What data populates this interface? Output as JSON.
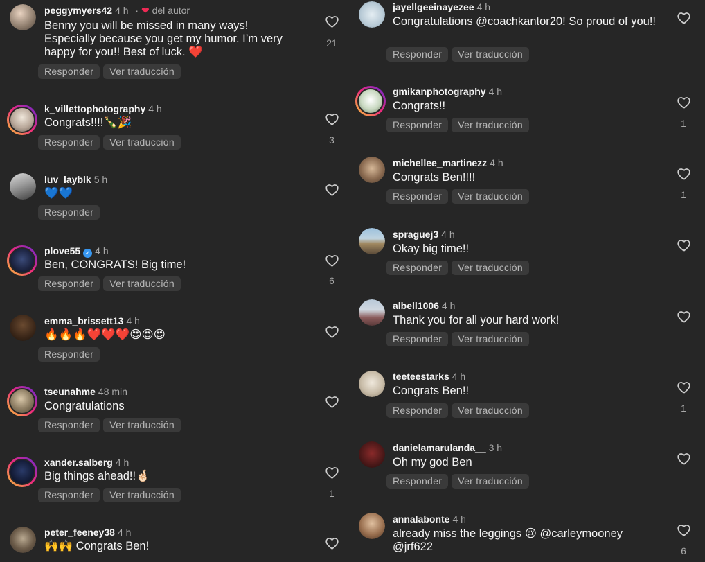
{
  "labels": {
    "reply": "Responder",
    "translate": "Ver traducción"
  },
  "left_comments": [
    {
      "user": "peggymyers42",
      "time": "4 h",
      "by_author": "del autor",
      "text": "Benny you will be missed in many ways! Especially because you get my humor. I’m very happy for you!! Best of luck. ❤️",
      "likes": "21"
    },
    {
      "user": "k_villettophotography",
      "time": "4 h",
      "text": "Congrats!!!!🍾🎉",
      "likes": "3"
    },
    {
      "user": "luv_layblk",
      "time": "5 h",
      "text": "💙💙",
      "likes": ""
    },
    {
      "user": "plove55",
      "time": "4 h",
      "text": "Ben, CONGRATS! Big time!",
      "likes": "6"
    },
    {
      "user": "emma_brissett13",
      "time": "4 h",
      "text": "🔥🔥🔥❤️❤️❤️😍😍😍",
      "likes": ""
    },
    {
      "user": "tseunahme",
      "time": "48 min",
      "text": "Congratulations",
      "likes": ""
    },
    {
      "user": "xander.salberg",
      "time": "4 h",
      "text": "Big things ahead!!🤞🏻",
      "likes": "1"
    },
    {
      "user": "peter_feeney38",
      "time": "4 h",
      "text": "🙌🙌 Congrats Ben!",
      "likes": ""
    }
  ],
  "right_comments": [
    {
      "user": "jayellgeeinayezee",
      "time": "4 h",
      "text": "Congratulations @coachkantor20! So proud of you!!",
      "likes": ""
    },
    {
      "user": "gmikanphotography",
      "time": "4 h",
      "text": "Congrats!!",
      "likes": "1"
    },
    {
      "user": "michellee_martinezz",
      "time": "4 h",
      "text": "Congrats Ben!!!!",
      "likes": "1"
    },
    {
      "user": "spraguej3",
      "time": "4 h",
      "text": "Okay big time!!",
      "likes": ""
    },
    {
      "user": "albell1006",
      "time": "4 h",
      "text": "Thank you for all your hard work!",
      "likes": ""
    },
    {
      "user": "teeteestarks",
      "time": "4 h",
      "text": "Congrats Ben!!",
      "likes": "1"
    },
    {
      "user": "danielamarulanda__",
      "time": "3 h",
      "text": "Oh my god Ben",
      "likes": ""
    },
    {
      "user": "annalabonte",
      "time": "4 h",
      "text": "already miss the leggings 😢 @carleymooney @jrf622",
      "likes": "6"
    }
  ],
  "colors": {
    "background": "#262626",
    "button_bg": "#3a3a3a",
    "muted_text": "#a8a8a8",
    "verified": "#3897f0",
    "author_heart": "#ee2a55"
  }
}
